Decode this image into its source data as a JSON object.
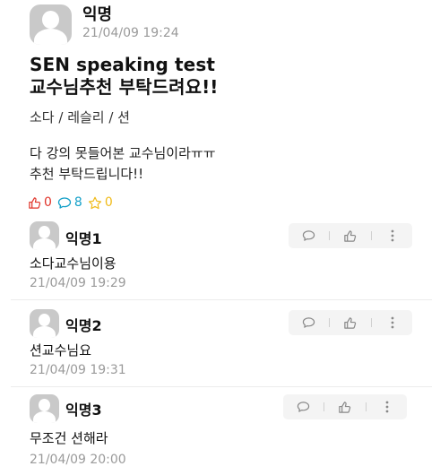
{
  "post": {
    "author": "익명",
    "time": "21/04/09 19:24",
    "title": "SEN speaking test\n교수님추천 부탁드려요!!",
    "tags": "소다 / 레슬리 / 션",
    "body": "다 강의 못들어본 교수님이라ㅠㅠ\n추천 부탁드립니다!!",
    "likes": "0",
    "comments": "8",
    "scraps": "0",
    "icons": {
      "like": "thumbs-up-icon",
      "comment": "speech-bubble-icon",
      "scrap": "star-icon",
      "avatar": "default-avatar-icon"
    },
    "colors": {
      "like": "#e0342a",
      "comment": "#14a0c8",
      "scrap": "#f0bb1a"
    }
  },
  "comments": [
    {
      "author": "익명1",
      "text": "소다교수님이용",
      "time": "21/04/09 19:29"
    },
    {
      "author": "익명2",
      "text": "션교수님요",
      "time": "21/04/09 19:31"
    },
    {
      "author": "익명3",
      "text": "무조건 션해라",
      "time": "21/04/09 20:00"
    }
  ]
}
